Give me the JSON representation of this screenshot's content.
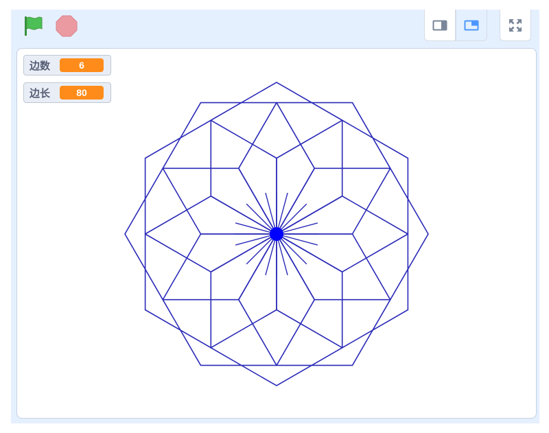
{
  "toolbar": {
    "green_flag": "green-flag-icon",
    "stop": "stop-sign-icon",
    "small_stage": "small-stage-icon",
    "large_stage": "large-stage-icon",
    "fullscreen": "fullscreen-icon"
  },
  "monitors": [
    {
      "label": "边数",
      "value": "6"
    },
    {
      "label": "边长",
      "value": "80"
    }
  ],
  "drawing": {
    "stroke_color": "#2a2ab8",
    "center_color": "#0000ff"
  },
  "colors": {
    "accent": "#4c97ff",
    "monitor_value": "#ff8c1a",
    "flag": "#4cbf56",
    "stop": "#ec9aa1"
  }
}
